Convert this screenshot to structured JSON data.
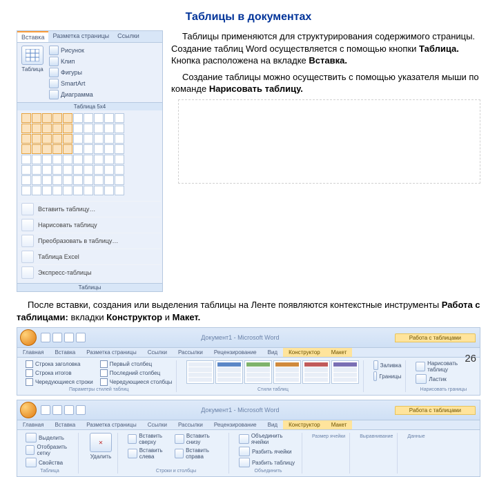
{
  "title": "Таблицы в документах",
  "paragraphs": {
    "p1a": "Таблицы применяются для структурирования содержимого страницы. Создание таблиц Word осуществляется с помощью кнопки ",
    "p1b": "Таблица.",
    "p1c": " Кнопка расположена на вкладке ",
    "p1d": "Вставка.",
    "p2a": "Создание таблицы можно осуществить с помощью указателя мыши по команде ",
    "p2b": "Нарисовать таблицу."
  },
  "insert_panel": {
    "tabs": [
      "Вставка",
      "Разметка страницы",
      "Ссылки"
    ],
    "big_button": "Таблица",
    "mini": [
      "Рисунок",
      "Клип",
      "Фигуры",
      "SmartArt",
      "Диаграмма"
    ],
    "size_label": "Таблица 5x4",
    "menu": [
      "Вставить таблицу…",
      "Нарисовать таблицу",
      "Преобразовать в таблицу…",
      "Таблица Excel",
      "Экспресс-таблицы"
    ],
    "group_label": "Таблицы"
  },
  "after": {
    "p1a": "После вставки, создания или выделения таблицы на Ленте появляются контекстные инструменты ",
    "p1b": "Работа с таблицами:",
    "p1c": " вкладки ",
    "p1d": "Конструктор",
    "p1e": " и ",
    "p1f": "Макет."
  },
  "ribbon_common": {
    "doc_title": "Документ1 - Microsoft Word",
    "context_title": "Работа с таблицами",
    "tabs": [
      "Главная",
      "Вставка",
      "Разметка страницы",
      "Ссылки",
      "Рассылки",
      "Рецензирование",
      "Вид",
      "Конструктор",
      "Макет"
    ]
  },
  "ribbon1": {
    "checks": [
      "Строка заголовка",
      "Строка итогов",
      "Чередующиеся строки",
      "Первый столбец",
      "Последний столбец",
      "Чередующиеся столбцы"
    ],
    "group1": "Параметры стилей таблиц",
    "group2": "Стили таблиц",
    "btns": [
      "Заливка",
      "Границы"
    ],
    "group3": "Нарисовать границы",
    "draw_btns": [
      "Нарисовать таблицу",
      "Ластик"
    ]
  },
  "ribbon2": {
    "g_rows": [
      "Выделить",
      "Отобразить сетку",
      "Свойства"
    ],
    "g_rows_label": "Таблица",
    "g_del": "Удалить",
    "g_ins": [
      "Вставить сверху",
      "Вставить снизу",
      "Вставить слева",
      "Вставить справа"
    ],
    "g_ins_label": "Строки и столбцы",
    "g_merge": [
      "Объединить ячейки",
      "Разбить ячейки",
      "Разбить таблицу"
    ],
    "g_merge_label": "Объединить",
    "g_size_label": "Размер ячейки",
    "g_align_label": "Выравнивание",
    "g_data_label": "Данные"
  },
  "page_number": "26"
}
